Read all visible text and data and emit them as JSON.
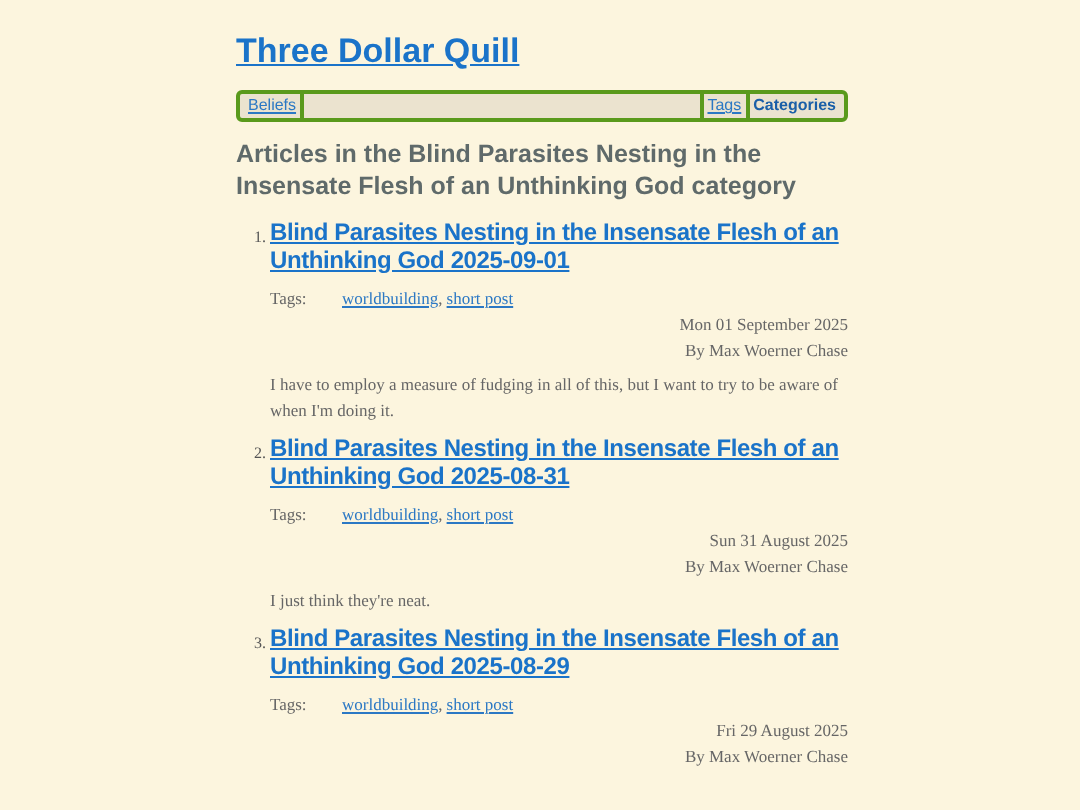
{
  "site_title": "Three Dollar Quill",
  "nav": [
    {
      "label": "Beliefs",
      "selected": false
    },
    {
      "label": "Tags",
      "selected": false
    },
    {
      "label": "Categories",
      "selected": true
    }
  ],
  "heading": "Articles in the Blind Parasites Nesting in the Insensate Flesh of an Unthinking God category",
  "articles": [
    {
      "number": "1.",
      "title": "Blind Parasites Nesting in the Insensate Flesh of an Unthinking God 2025-09-01",
      "tags_label": "Tags:",
      "tags": [
        "worldbuilding",
        "short post"
      ],
      "tag_separator": ",",
      "date": "Mon 01 September 2025",
      "author": "By Max Woerner Chase",
      "summary": "I have to employ a measure of fudging in all of this, but I want to try to be aware of when I'm doing it."
    },
    {
      "number": "2.",
      "title": "Blind Parasites Nesting in the Insensate Flesh of an Unthinking God 2025-08-31",
      "tags_label": "Tags:",
      "tags": [
        "worldbuilding",
        "short post"
      ],
      "tag_separator": ",",
      "date": "Sun 31 August 2025",
      "author": "By Max Woerner Chase",
      "summary": "I just think they're neat."
    },
    {
      "number": "3.",
      "title": "Blind Parasites Nesting in the Insensate Flesh of an Unthinking God 2025-08-29",
      "tags_label": "Tags:",
      "tags": [
        "worldbuilding",
        "short post"
      ],
      "tag_separator": ",",
      "date": "Fri 29 August 2025",
      "author": "By Max Woerner Chase"
    }
  ]
}
